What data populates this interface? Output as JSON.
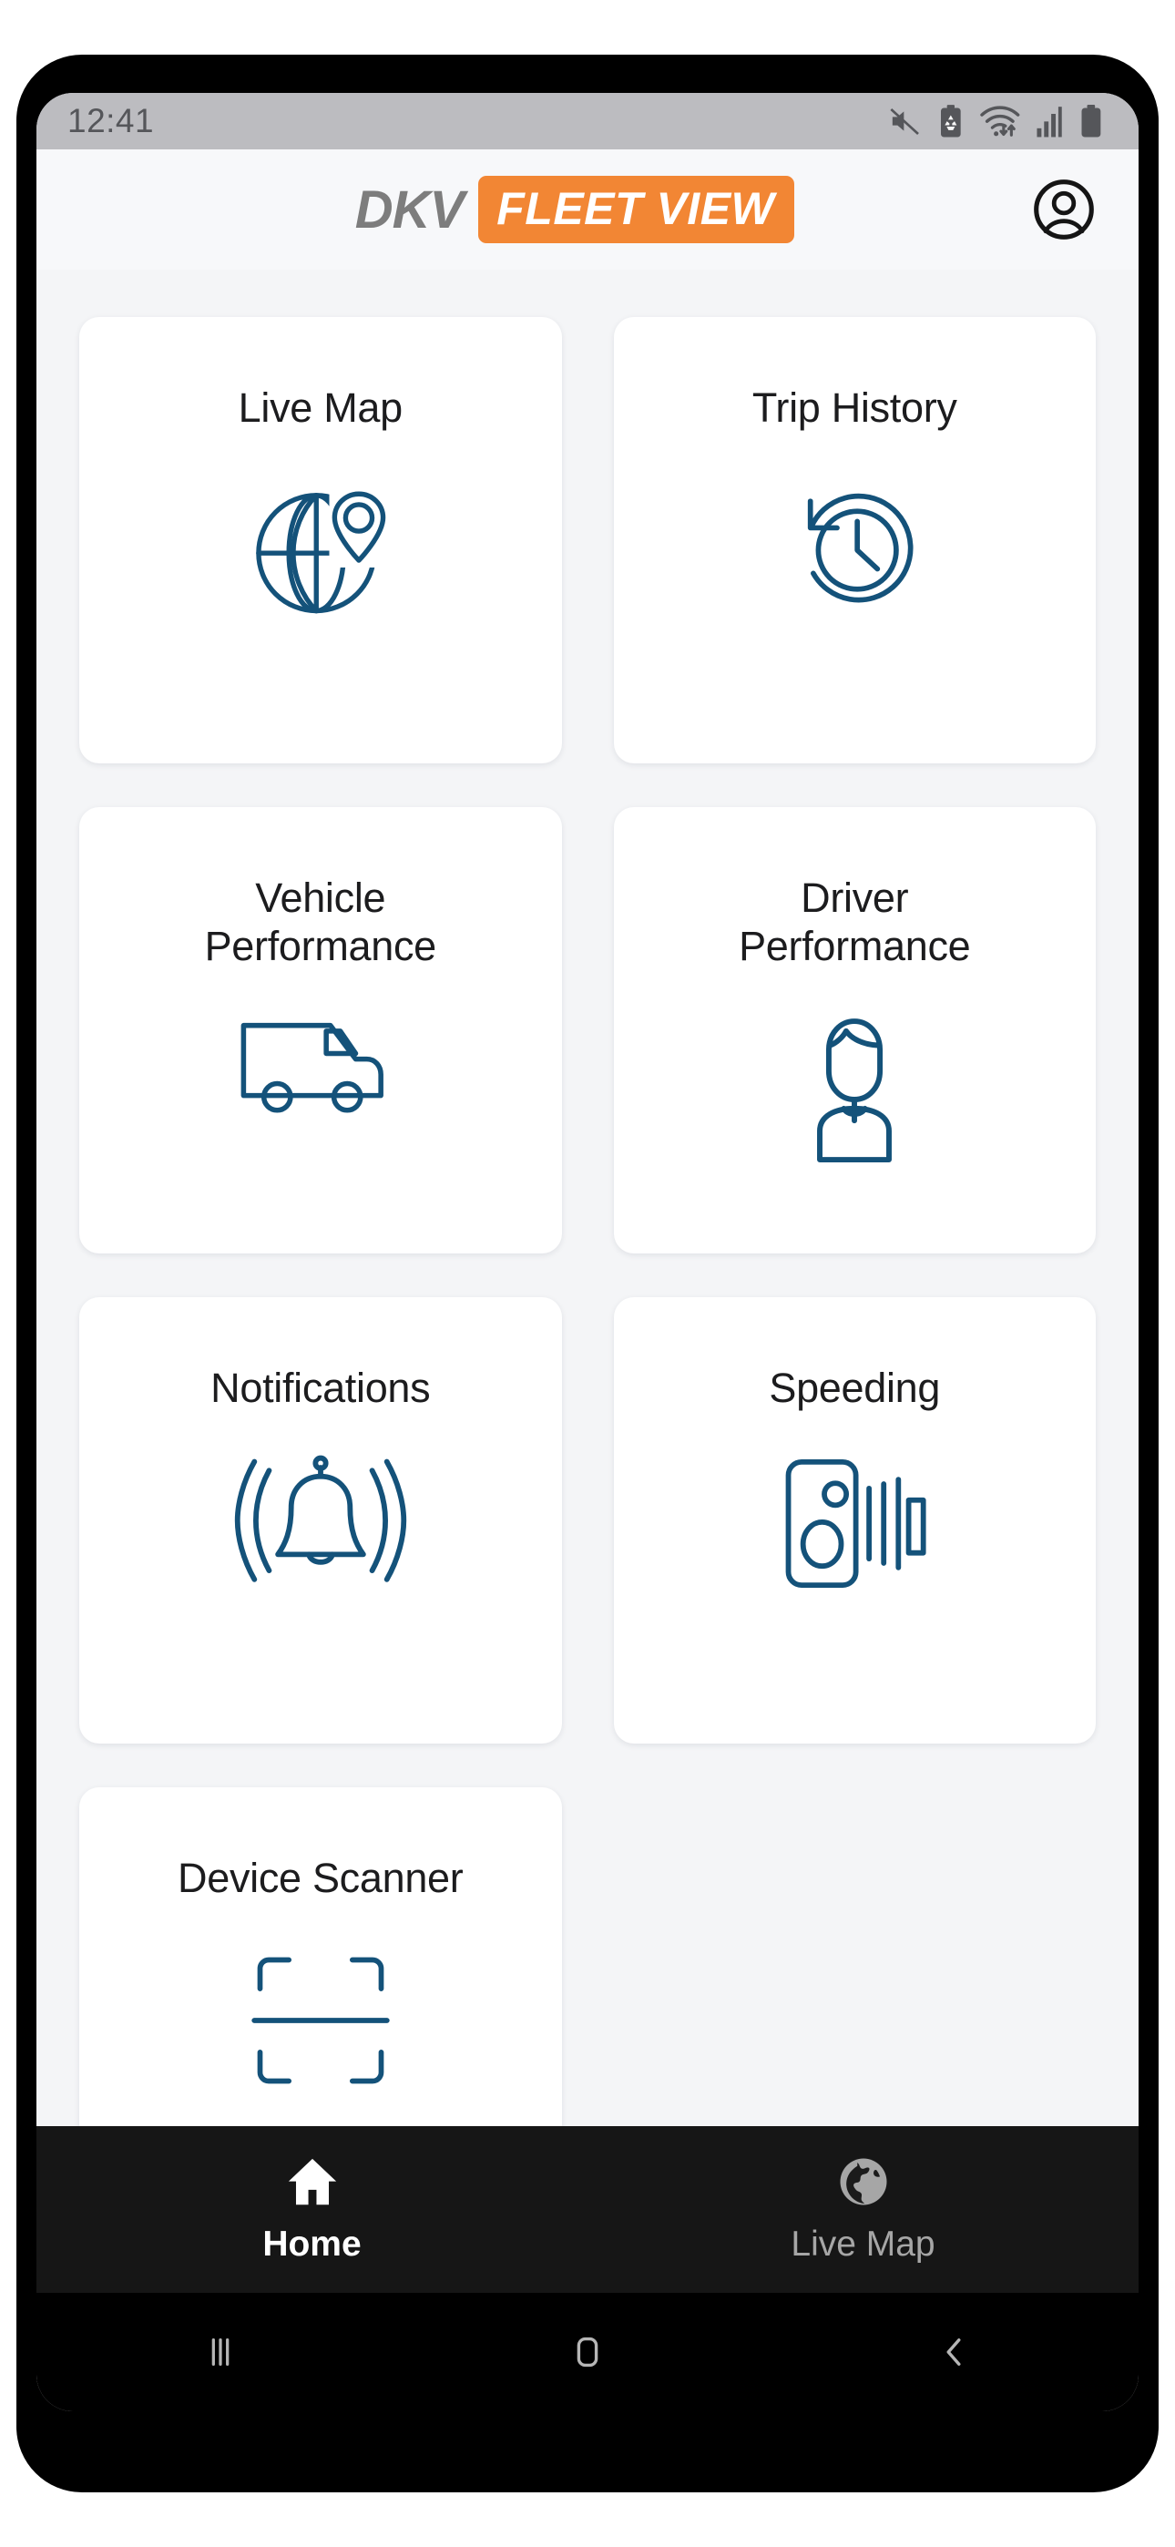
{
  "status_bar": {
    "time": "12:41",
    "icons": [
      "mute-icon",
      "battery-saver-icon",
      "wifi-icon",
      "cellular-signal-icon",
      "battery-icon"
    ]
  },
  "header": {
    "brand_primary": "DKV",
    "brand_secondary": "FLEET VIEW",
    "profile_icon": "account-circle-icon",
    "brand_orange": "#F28634",
    "brand_gray": "#7D7D7D"
  },
  "tiles": [
    {
      "label": "Live Map",
      "icon": "globe-pin-icon"
    },
    {
      "label": "Trip History",
      "icon": "clock-history-icon"
    },
    {
      "label": "Vehicle\nPerformance",
      "label_line1": "Vehicle",
      "label_line2": "Performance",
      "icon": "van-icon"
    },
    {
      "label": "Driver\nPerformance",
      "label_line1": "Driver",
      "label_line2": "Performance",
      "icon": "driver-person-icon"
    },
    {
      "label": "Notifications",
      "icon": "bell-ringing-icon"
    },
    {
      "label": "Speeding",
      "icon": "speed-camera-icon"
    },
    {
      "label": "Device Scanner",
      "icon": "scanner-icon"
    }
  ],
  "tile_icon_color": "#14527A",
  "tab_bar": {
    "items": [
      {
        "label": "Home",
        "icon": "home-icon",
        "active": true
      },
      {
        "label": "Live Map",
        "icon": "globe-icon",
        "active": false
      }
    ]
  },
  "system_nav": {
    "buttons": [
      {
        "name": "recent-apps-button",
        "icon": "recents-icon"
      },
      {
        "name": "home-button",
        "icon": "home-square-icon"
      },
      {
        "name": "back-button",
        "icon": "back-chevron-icon"
      }
    ]
  }
}
